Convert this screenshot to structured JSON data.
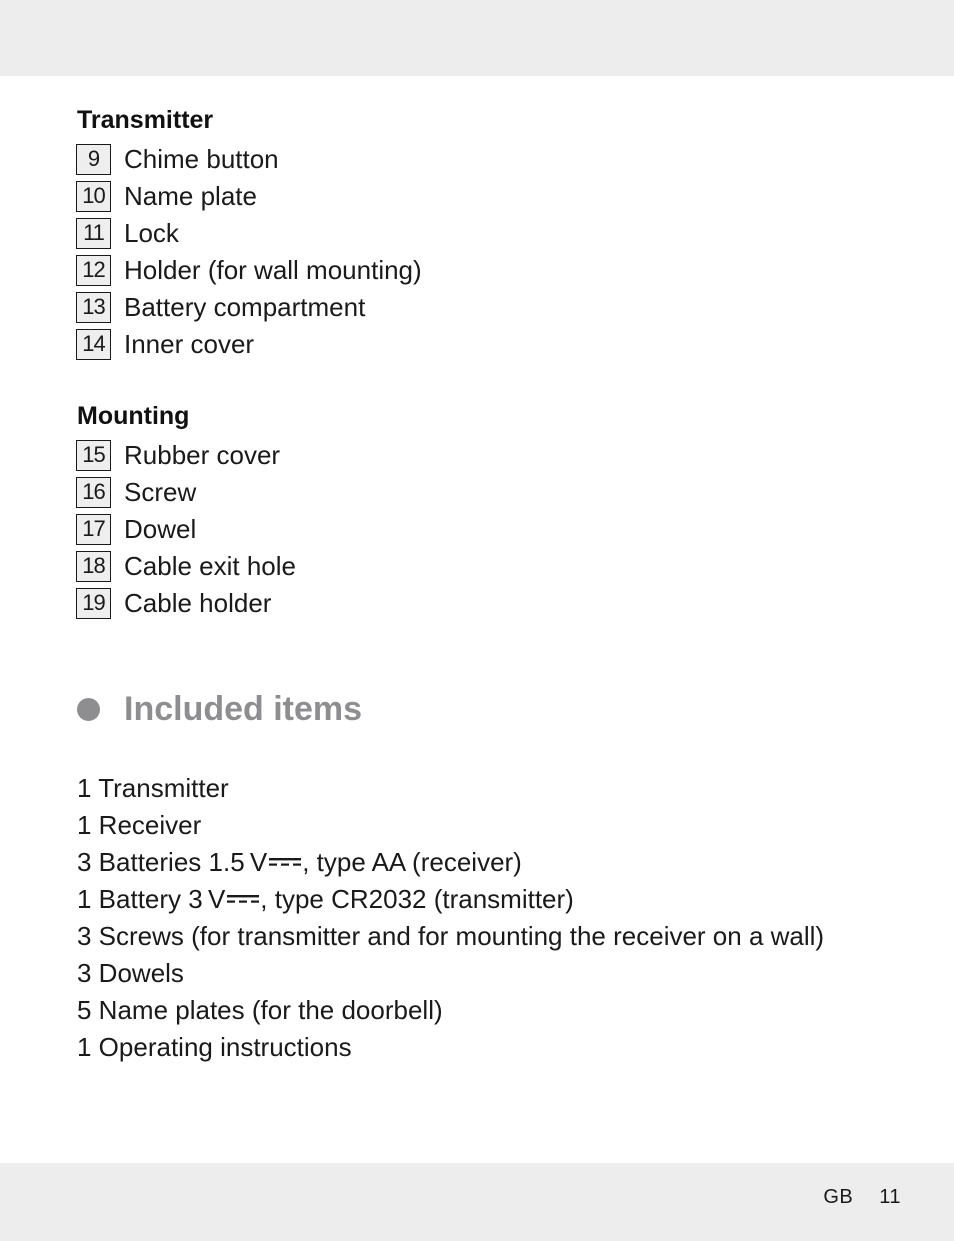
{
  "transmitter": {
    "heading": "Transmitter",
    "items": [
      {
        "num": "9",
        "label": "Chime button"
      },
      {
        "num": "10",
        "label": "Name plate"
      },
      {
        "num": "11",
        "label": "Lock"
      },
      {
        "num": "12",
        "label": "Holder (for wall mounting)"
      },
      {
        "num": "13",
        "label": "Battery compartment"
      },
      {
        "num": "14",
        "label": "Inner cover"
      }
    ]
  },
  "mounting": {
    "heading": "Mounting",
    "items": [
      {
        "num": "15",
        "label": "Rubber cover"
      },
      {
        "num": "16",
        "label": "Screw"
      },
      {
        "num": "17",
        "label": "Dowel"
      },
      {
        "num": "18",
        "label": "Cable exit hole"
      },
      {
        "num": "19",
        "label": "Cable holder"
      }
    ]
  },
  "included": {
    "title": "Included items",
    "bullet_color": "#8e8e90",
    "items": [
      {
        "text": "1 Transmitter"
      },
      {
        "text": "1 Receiver"
      },
      {
        "pre": "3 Batteries 1.5 V",
        "icon": "dc-voltage-icon",
        "post": ", type AA (receiver)"
      },
      {
        "pre": "1 Battery 3 V",
        "icon": "dc-voltage-icon",
        "post": ", type CR2032 (transmitter)"
      },
      {
        "text": "3 Screws (for transmitter and for mounting the receiver on a wall)"
      },
      {
        "text": "3 Dowels"
      },
      {
        "text": "5 Name plates (for the doorbell)"
      },
      {
        "text": "1 Operating instructions"
      }
    ]
  },
  "footer": {
    "language": "GB",
    "page_number": "11"
  }
}
